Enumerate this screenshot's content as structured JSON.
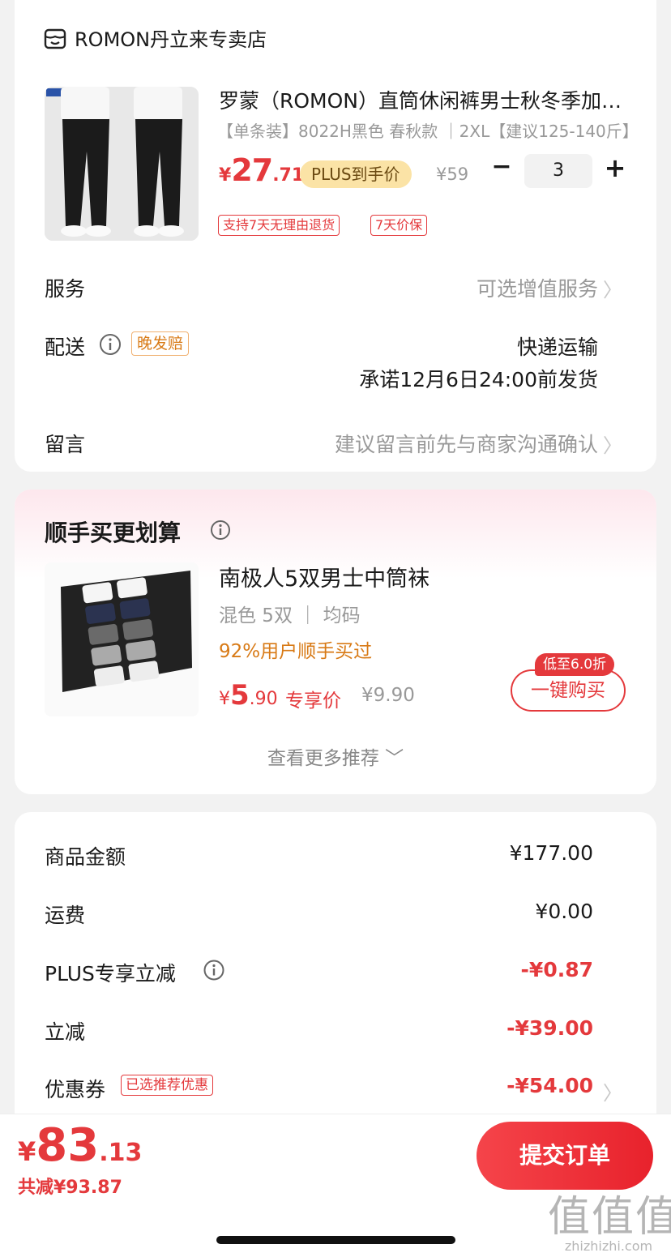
{
  "store": {
    "name": "ROMON丹立来专卖店",
    "icon": "store-icon"
  },
  "product": {
    "title": "罗蒙（ROMON）直筒休闲裤男士秋冬季加绒加厚运动裤",
    "spec": "【单条装】8022H黑色 春秋款 ｜2XL【建议125-140斤】",
    "price_symbol": "¥",
    "price_int": "27",
    "price_dec": ".71",
    "plus_badge": "PLUS到手价",
    "original_price": "¥59",
    "qty_minus": "−",
    "quantity": "3",
    "qty_plus": "+",
    "tags": [
      "支持7天无理由退货",
      "7天价保"
    ]
  },
  "service": {
    "label": "服务",
    "value": "可选增值服务",
    "chevron": "〉"
  },
  "shipping": {
    "label": "配送",
    "badge": "晚发赔",
    "method": "快递运输",
    "promise": "承诺12月6日24:00前发货"
  },
  "message": {
    "label": "留言",
    "placeholder": "建议留言前先与商家沟通确认",
    "chevron": "〉"
  },
  "addon": {
    "title": "顺手买更划算",
    "item": {
      "name": "南极人5双男士中筒袜",
      "spec": "混色 5双 ｜ 均码",
      "percent": "92%用户顺手买过",
      "price_symbol": "¥",
      "price_int": "5",
      "price_dec": ".90",
      "exclusive": "专享价",
      "original_price": "¥9.90",
      "discount_badge": "低至6.0折",
      "buy_label": "一键购买"
    },
    "more": "查看更多推荐 ﹀"
  },
  "summary": {
    "rows": [
      {
        "label": "商品金额",
        "value": "¥177.00"
      },
      {
        "label": "运费",
        "value": "¥0.00"
      },
      {
        "label": "PLUS专享立减",
        "value": "-¥0.87"
      },
      {
        "label": "立减",
        "value": "-¥39.00"
      },
      {
        "label": "优惠券",
        "value": "-¥54.00",
        "badge": "已选推荐优惠"
      }
    ],
    "chevron": "〉"
  },
  "footer": {
    "price_symbol": "¥",
    "price_int": "83",
    "price_dec": ".13",
    "saved": "共减¥93.87",
    "submit": "提交订单",
    "watermark": "值值值",
    "watermark_url": "zhizhizhi.com"
  },
  "colors": {
    "accent": "#e4393c",
    "plus_bg": "#fbe3a6",
    "orange": "#d87a16"
  }
}
